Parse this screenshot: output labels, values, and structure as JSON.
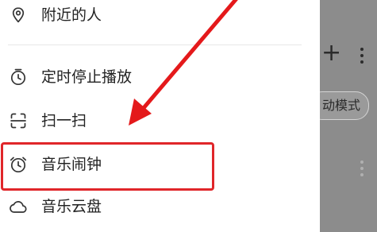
{
  "menu": {
    "items": [
      {
        "label": "附近的人",
        "icon": "location-pin-icon"
      },
      {
        "label": "定时停止播放",
        "icon": "timer-icon"
      },
      {
        "label": "扫一扫",
        "icon": "scan-icon"
      },
      {
        "label": "音乐闹钟",
        "icon": "alarm-clock-icon"
      },
      {
        "label": "音乐云盘",
        "icon": "cloud-icon"
      }
    ]
  },
  "background": {
    "mode_label": "动模式",
    "add_icon": "plus-icon",
    "more_icon": "more-vertical-icon"
  },
  "annotation": {
    "highlight_color": "#e0262a"
  }
}
